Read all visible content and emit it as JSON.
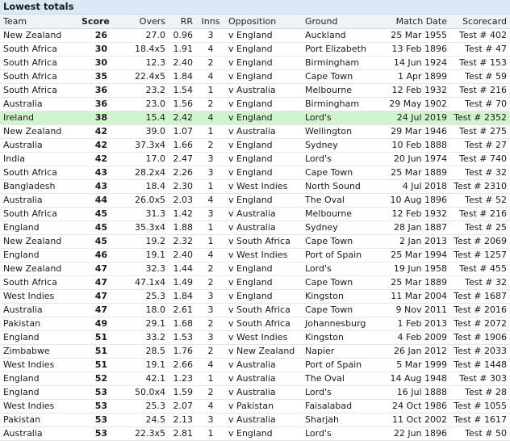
{
  "title": "Lowest totals",
  "highlight_color": "#d0f4cd",
  "headers": [
    "Team",
    "Score",
    "Overs",
    "RR",
    "Inns",
    "Opposition",
    "Ground",
    "Match Date",
    "Scorecard"
  ],
  "rows": [
    [
      "New Zealand",
      "26",
      "27.0",
      "0.96",
      "3",
      "v England",
      "Auckland",
      "25 Mar 1955",
      "Test # 402"
    ],
    [
      "South Africa",
      "30",
      "18.4x5",
      "1.91",
      "4",
      "v England",
      "Port Elizabeth",
      "13 Feb 1896",
      "Test # 47"
    ],
    [
      "South Africa",
      "30",
      "12.3",
      "2.40",
      "2",
      "v England",
      "Birmingham",
      "14 Jun 1924",
      "Test # 153"
    ],
    [
      "South Africa",
      "35",
      "22.4x5",
      "1.84",
      "4",
      "v England",
      "Cape Town",
      "1 Apr 1899",
      "Test # 59"
    ],
    [
      "South Africa",
      "36",
      "23.2",
      "1.54",
      "1",
      "v Australia",
      "Melbourne",
      "12 Feb 1932",
      "Test # 216"
    ],
    [
      "Australia",
      "36",
      "23.0",
      "1.56",
      "2",
      "v England",
      "Birmingham",
      "29 May 1902",
      "Test # 70"
    ],
    [
      "Ireland",
      "38",
      "15.4",
      "2.42",
      "4",
      "v England",
      "Lord's",
      "24 Jul 2019",
      "Test # 2352"
    ],
    [
      "New Zealand",
      "42",
      "39.0",
      "1.07",
      "1",
      "v Australia",
      "Wellington",
      "29 Mar 1946",
      "Test # 275"
    ],
    [
      "Australia",
      "42",
      "37.3x4",
      "1.66",
      "2",
      "v England",
      "Sydney",
      "10 Feb 1888",
      "Test # 27"
    ],
    [
      "India",
      "42",
      "17.0",
      "2.47",
      "3",
      "v England",
      "Lord's",
      "20 Jun 1974",
      "Test # 740"
    ],
    [
      "South Africa",
      "43",
      "28.2x4",
      "2.26",
      "3",
      "v England",
      "Cape Town",
      "25 Mar 1889",
      "Test # 32"
    ],
    [
      "Bangladesh",
      "43",
      "18.4",
      "2.30",
      "1",
      "v West Indies",
      "North Sound",
      "4 Jul 2018",
      "Test # 2310"
    ],
    [
      "Australia",
      "44",
      "26.0x5",
      "2.03",
      "4",
      "v England",
      "The Oval",
      "10 Aug 1896",
      "Test # 52"
    ],
    [
      "South Africa",
      "45",
      "31.3",
      "1.42",
      "3",
      "v Australia",
      "Melbourne",
      "12 Feb 1932",
      "Test # 216"
    ],
    [
      "England",
      "45",
      "35.3x4",
      "1.88",
      "1",
      "v Australia",
      "Sydney",
      "28 Jan 1887",
      "Test # 25"
    ],
    [
      "New Zealand",
      "45",
      "19.2",
      "2.32",
      "1",
      "v South Africa",
      "Cape Town",
      "2 Jan 2013",
      "Test # 2069"
    ],
    [
      "England",
      "46",
      "19.1",
      "2.40",
      "4",
      "v West Indies",
      "Port of Spain",
      "25 Mar 1994",
      "Test # 1257"
    ],
    [
      "New Zealand",
      "47",
      "32.3",
      "1.44",
      "2",
      "v England",
      "Lord's",
      "19 Jun 1958",
      "Test # 455"
    ],
    [
      "South Africa",
      "47",
      "47.1x4",
      "1.49",
      "2",
      "v England",
      "Cape Town",
      "25 Mar 1889",
      "Test # 32"
    ],
    [
      "West Indies",
      "47",
      "25.3",
      "1.84",
      "3",
      "v England",
      "Kingston",
      "11 Mar 2004",
      "Test # 1687"
    ],
    [
      "Australia",
      "47",
      "18.0",
      "2.61",
      "3",
      "v South Africa",
      "Cape Town",
      "9 Nov 2011",
      "Test # 2016"
    ],
    [
      "Pakistan",
      "49",
      "29.1",
      "1.68",
      "2",
      "v South Africa",
      "Johannesburg",
      "1 Feb 2013",
      "Test # 2072"
    ],
    [
      "England",
      "51",
      "33.2",
      "1.53",
      "3",
      "v West Indies",
      "Kingston",
      "4 Feb 2009",
      "Test # 1906"
    ],
    [
      "Zimbabwe",
      "51",
      "28.5",
      "1.76",
      "2",
      "v New Zealand",
      "Napier",
      "26 Jan 2012",
      "Test # 2033"
    ],
    [
      "West Indies",
      "51",
      "19.1",
      "2.66",
      "4",
      "v Australia",
      "Port of Spain",
      "5 Mar 1999",
      "Test # 1448"
    ],
    [
      "England",
      "52",
      "42.1",
      "1.23",
      "1",
      "v Australia",
      "The Oval",
      "14 Aug 1948",
      "Test # 303"
    ],
    [
      "England",
      "53",
      "50.0x4",
      "1.59",
      "2",
      "v Australia",
      "Lord's",
      "16 Jul 1888",
      "Test # 28"
    ],
    [
      "West Indies",
      "53",
      "25.3",
      "2.07",
      "4",
      "v Pakistan",
      "Faisalabad",
      "24 Oct 1986",
      "Test # 1055"
    ],
    [
      "Pakistan",
      "53",
      "24.5",
      "2.13",
      "3",
      "v Australia",
      "Sharjah",
      "11 Oct 2002",
      "Test # 1617"
    ],
    [
      "Australia",
      "53",
      "22.3x5",
      "2.81",
      "1",
      "v England",
      "Lord's",
      "22 Jun 1896",
      "Test # 50"
    ]
  ]
}
